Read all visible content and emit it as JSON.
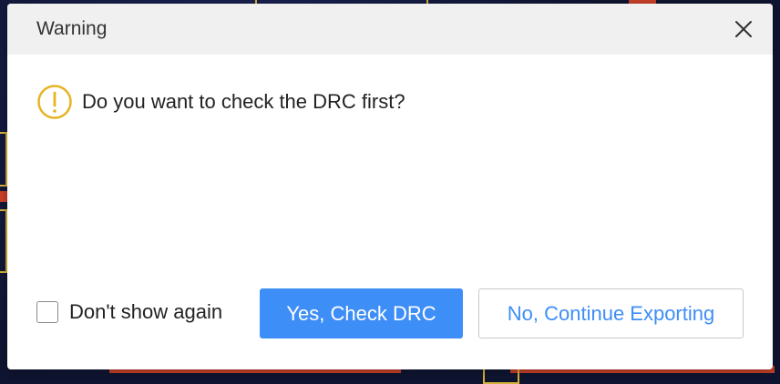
{
  "dialog": {
    "title": "Warning",
    "close_icon": "close-icon",
    "warning_icon": "warning-circle-icon",
    "message": "Do you want to check the DRC first?",
    "checkbox_label": "Don't show again",
    "checkbox_checked": false,
    "primary_button_label": "Yes, Check DRC",
    "secondary_button_label": "No, Continue Exporting"
  },
  "colors": {
    "accent": "#3e8ef7",
    "warning": "#e6b422",
    "header_bg": "#f0f0f0",
    "canvas_bg": "#0f1530",
    "trace": "#c9402a",
    "pad": "#d4b23a"
  }
}
